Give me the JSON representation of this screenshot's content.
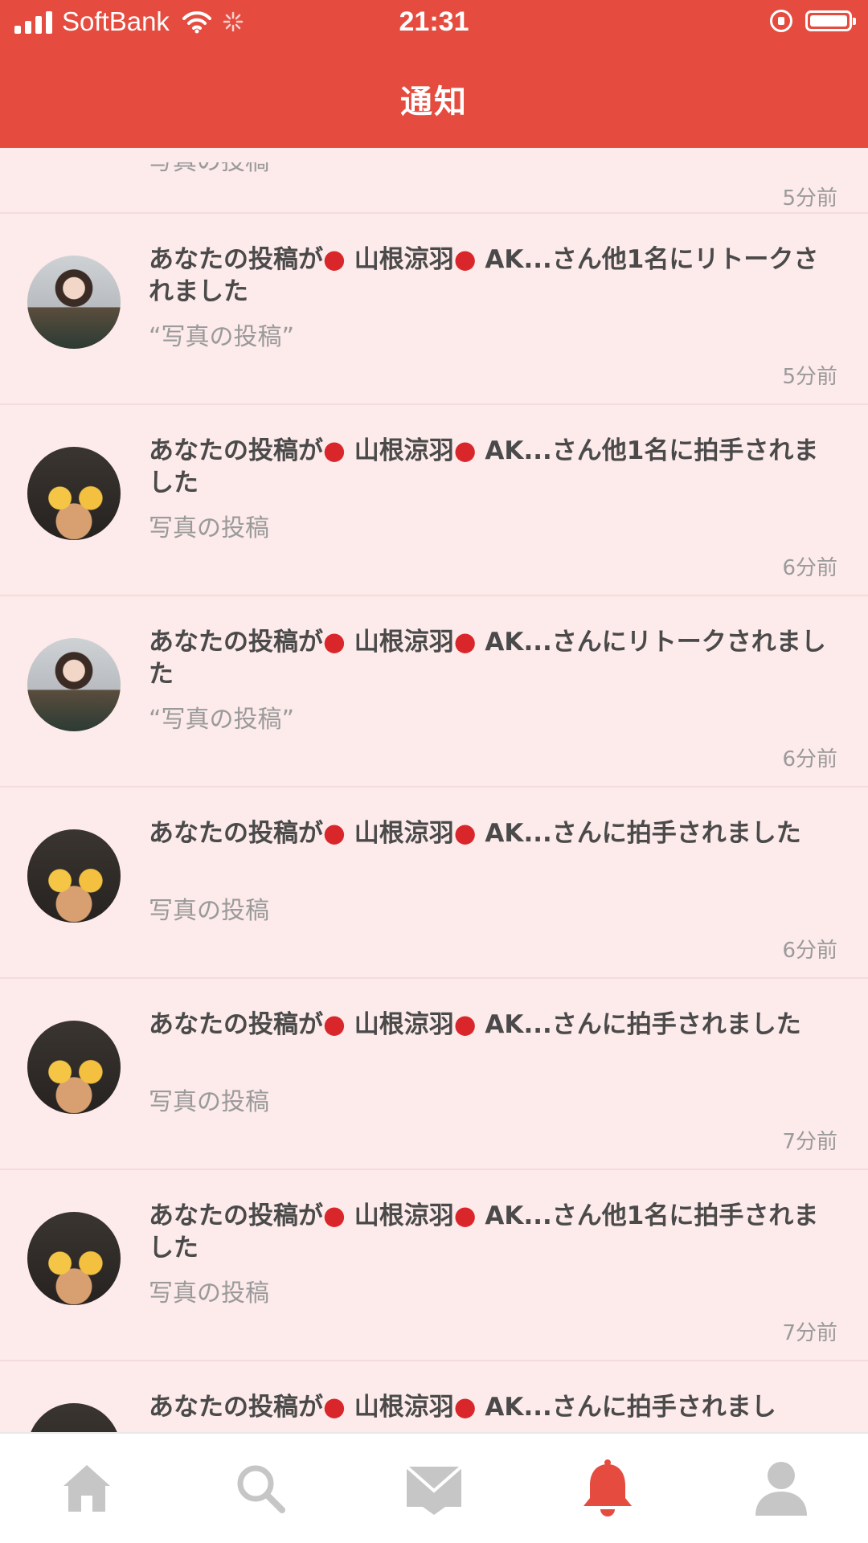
{
  "status_bar": {
    "carrier": "SoftBank",
    "time": "21:31"
  },
  "header": {
    "title": "通知"
  },
  "first_item": {
    "subtitle": "写真の投稿",
    "time": "5分前"
  },
  "items": [
    {
      "prefix": "あなたの投稿が",
      "name": "山根涼羽",
      "suffix": " AK...さん他1名にリトークされました",
      "subtitle": "“写真の投稿”",
      "time": "5分前",
      "avatar": "a"
    },
    {
      "prefix": "あなたの投稿が",
      "name": "山根涼羽",
      "suffix": " AK...さん他1名に拍手されました",
      "subtitle": "写真の投稿",
      "time": "6分前",
      "avatar": "b"
    },
    {
      "prefix": "あなたの投稿が",
      "name": "山根涼羽",
      "suffix": " AK...さんにリトークされました",
      "subtitle": "“写真の投稿”",
      "time": "6分前",
      "avatar": "a"
    },
    {
      "prefix": "あなたの投稿が",
      "name": "山根涼羽",
      "suffix": " AK...さんに拍手されました",
      "subtitle": "写真の投稿",
      "time": "6分前",
      "avatar": "b"
    },
    {
      "prefix": "あなたの投稿が",
      "name": "山根涼羽",
      "suffix": " AK...さんに拍手されました",
      "subtitle": "写真の投稿",
      "time": "7分前",
      "avatar": "b"
    },
    {
      "prefix": "あなたの投稿が",
      "name": "山根涼羽",
      "suffix": " AK...さん他1名に拍手されました",
      "subtitle": "写真の投稿",
      "time": "7分前",
      "avatar": "b"
    },
    {
      "prefix": "あなたの投稿が",
      "name": "山根涼羽",
      "suffix": " AK...さんに拍手されまし",
      "subtitle": "",
      "time": "",
      "avatar": "b"
    }
  ],
  "tab_bar": {
    "items": [
      {
        "icon": "home-icon",
        "active": false
      },
      {
        "icon": "search-icon",
        "active": false
      },
      {
        "icon": "mail-icon",
        "active": false
      },
      {
        "icon": "bell-icon",
        "active": true
      },
      {
        "icon": "profile-icon",
        "active": false
      }
    ]
  },
  "colors": {
    "accent": "#e54c3f",
    "list_background": "#fdeaea",
    "inactive_icon": "#c6c6c6"
  }
}
